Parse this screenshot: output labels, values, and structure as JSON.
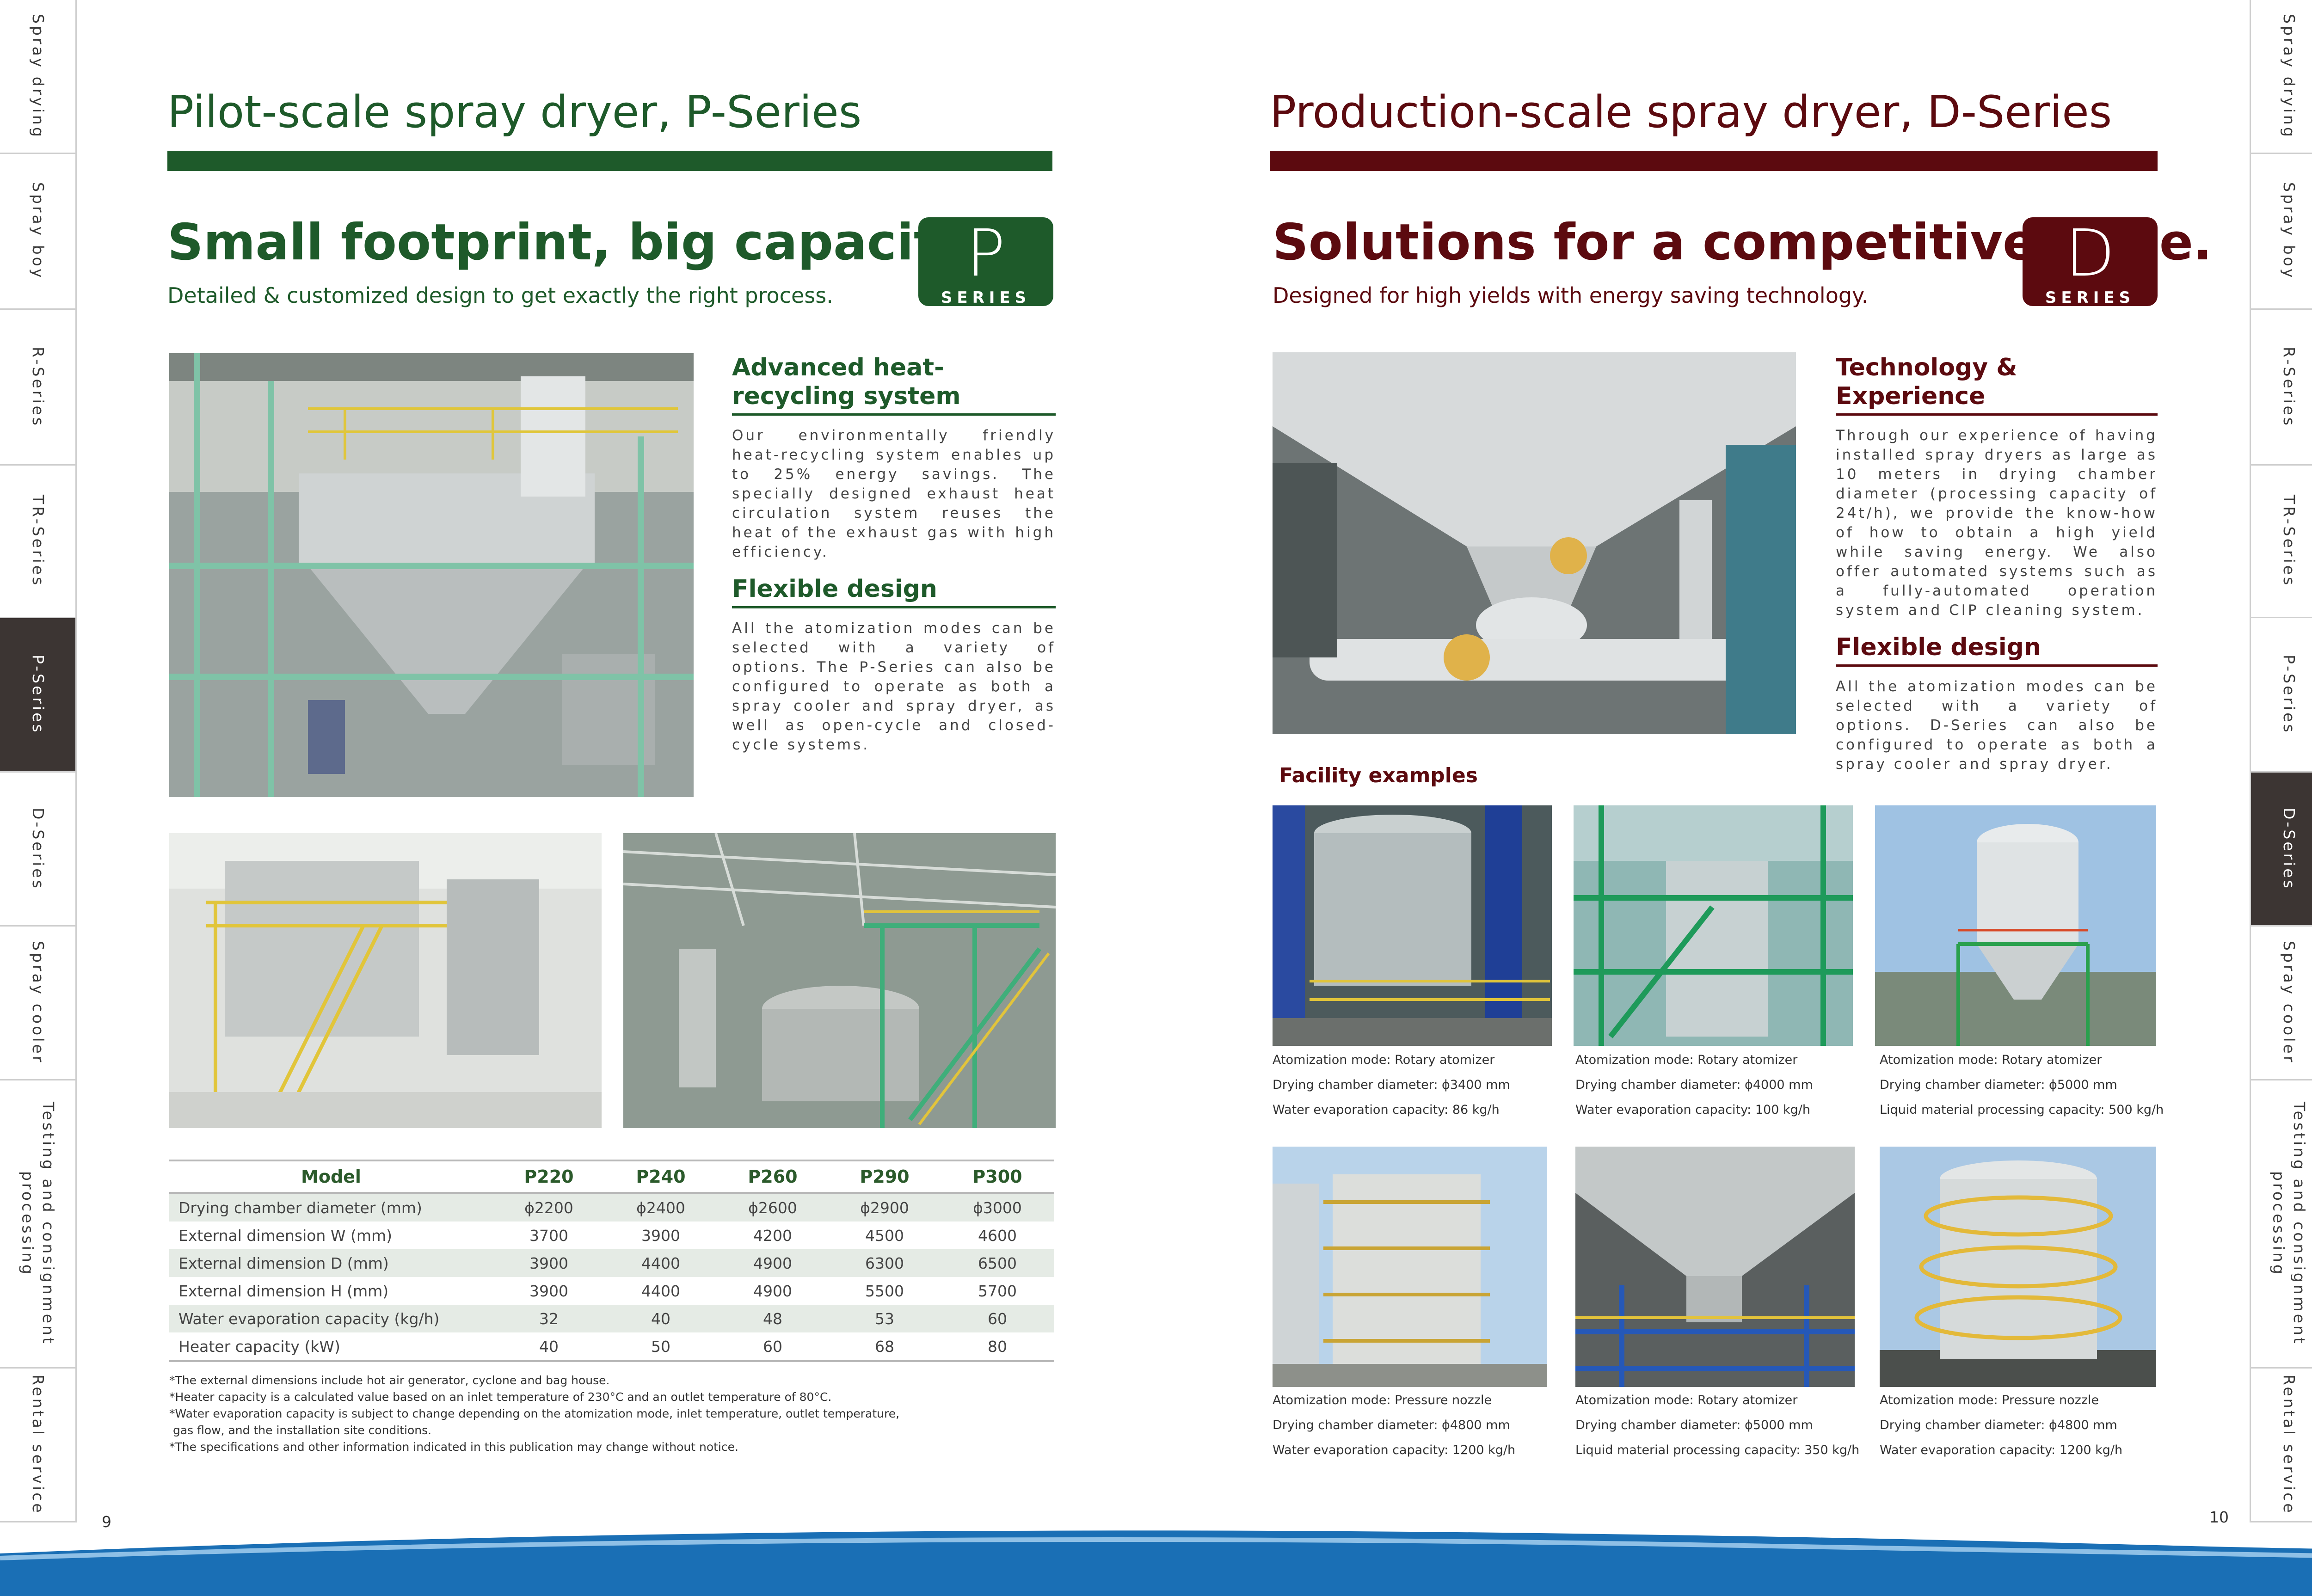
{
  "side_tabs": [
    "Spray drying",
    "Spray boy",
    "R-Series",
    "TR-Series",
    "P-Series",
    "D-Series",
    "Spray cooler",
    "Testing and consignment processing",
    "Rental service"
  ],
  "left_page": {
    "section_title": "Pilot-scale spray dryer, P-Series",
    "headline": "Small footprint, big capacity.",
    "subtitle": "Detailed & customized design to get exactly the right process.",
    "badge": {
      "letter": "P",
      "label": "SERIES"
    },
    "features": [
      {
        "title": "Advanced heat-recycling system",
        "text": "Our environmentally friendly heat-recycling system enables up to 25% energy savings. The specially designed exhaust heat circulation system reuses the heat of the exhaust gas with high efficiency."
      },
      {
        "title": "Flexible design",
        "text": "All the atomization modes can be selected with a variety of options. The P-Series can also be configured to operate as both a spray cooler and spray dryer, as well as open-cycle and closed-cycle systems."
      }
    ],
    "table": {
      "headers": [
        "Model",
        "P220",
        "P240",
        "P260",
        "P290",
        "P300"
      ],
      "rows": [
        [
          "Drying chamber diameter (mm)",
          "ϕ2200",
          "ϕ2400",
          "ϕ2600",
          "ϕ2900",
          "ϕ3000"
        ],
        [
          "External dimension W (mm)",
          "3700",
          "3900",
          "4200",
          "4500",
          "4600"
        ],
        [
          "External dimension D (mm)",
          "3900",
          "4400",
          "4900",
          "6300",
          "6500"
        ],
        [
          "External dimension H (mm)",
          "3900",
          "4400",
          "4900",
          "5500",
          "5700"
        ],
        [
          "Water evaporation capacity (kg/h)",
          "32",
          "40",
          "48",
          "53",
          "60"
        ],
        [
          "Heater capacity (kW)",
          "40",
          "50",
          "60",
          "68",
          "80"
        ]
      ]
    },
    "notes": [
      "*The external dimensions include hot air generator, cyclone and bag house.",
      "*Heater capacity is a calculated value based on an inlet temperature of 230°C and an outlet temperature of 80°C.",
      "*Water evaporation capacity is subject to change depending on the atomization mode, inlet temperature, outlet temperature,",
      " gas flow, and the installation site conditions.",
      "*The specifications and other information indicated in this publication may change without notice."
    ],
    "page_number": "9"
  },
  "right_page": {
    "section_title": "Production-scale spray dryer, D-Series",
    "headline": "Solutions for a competitive edge.",
    "subtitle": "Designed for high yields with energy saving technology.",
    "badge": {
      "letter": "D",
      "label": "SERIES"
    },
    "features": [
      {
        "title": "Technology & Experience",
        "text": "Through our experience of having installed spray dryers as large as 10 meters in drying chamber diameter (processing capacity of 24t/h), we provide the know-how of how to obtain a high yield while saving energy. We also offer automated systems such as a fully-automated operation system and CIP cleaning system."
      },
      {
        "title": "Flexible design",
        "text": "All the atomization modes can be selected with a variety of options. D-Series can also be configured to operate as both a spray cooler and spray dryer."
      }
    ],
    "facility_title": "Facility examples",
    "facilities": [
      [
        "Atomization mode: Rotary atomizer",
        "Drying chamber diameter: ϕ3400 mm",
        "Water evaporation capacity: 86 kg/h"
      ],
      [
        "Atomization mode: Rotary atomizer",
        "Drying chamber diameter: ϕ4000 mm",
        "Water evaporation capacity: 100 kg/h"
      ],
      [
        "Atomization mode: Rotary atomizer",
        "Drying chamber diameter: ϕ5000 mm",
        "Liquid material processing capacity: 500 kg/h"
      ],
      [
        "Atomization mode: Pressure nozzle",
        "Drying chamber diameter: ϕ4800 mm",
        "Water evaporation capacity: 1200 kg/h"
      ],
      [
        "Atomization mode: Rotary atomizer",
        "Drying chamber diameter: ϕ5000 mm",
        "Liquid material processing capacity: 350 kg/h"
      ],
      [
        "Atomization mode: Pressure nozzle",
        "Drying chamber diameter: ϕ4800 mm",
        "Water evaporation capacity: 1200 kg/h"
      ]
    ],
    "page_number": "10"
  },
  "colors": {
    "green": "#1e5a2a",
    "maroon": "#5c0a0f",
    "blue_band": "#1a6fb5",
    "tab_active": "#3c3533"
  }
}
